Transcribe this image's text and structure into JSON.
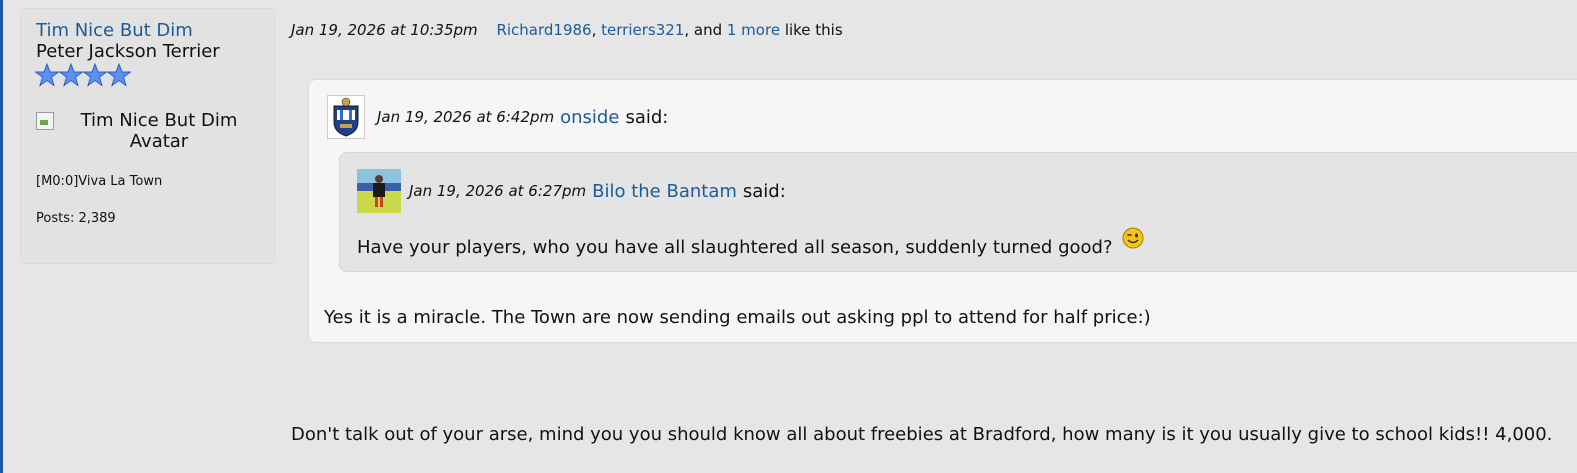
{
  "user": {
    "name": "Tim Nice But Dim",
    "title": "Peter Jackson Terrier",
    "stars": 4,
    "avatar_alt": "Tim Nice But Dim Avatar",
    "rank": "[M0:0]Viva La Town",
    "posts": "Posts: 2,389"
  },
  "post": {
    "date": "Jan 19, 2026 at 10:35pm",
    "likes": {
      "user1": "Richard1986",
      "sep1": ", ",
      "user2": "terriers321",
      "sep2": ", and ",
      "more": "1 more",
      "suffix": " like this"
    },
    "reply": "Don't talk out of your arse, mind you you should know all about freebies at Bradford, how many is it you usually give to school kids!! 4,000."
  },
  "outer_quote": {
    "date": "Jan 19, 2026 at 6:42pm",
    "user": "onside",
    "said": "said:",
    "text": "Yes it is a miracle. The Town are now sending emails out asking ppl to attend for half price:)"
  },
  "inner_quote": {
    "date": "Jan 19, 2026 at 6:27pm",
    "user": "Bilo the Bantam",
    "said": "said:",
    "text": "Have your players, who you have all slaughtered all season, suddenly turned good?"
  },
  "icons": {
    "star": "star-icon",
    "smiley": "wink-smiley-icon",
    "broken_image": "broken-image-icon"
  },
  "colors": {
    "link": "#1c5b9b",
    "background": "#e6e6e6",
    "outer_quote_bg": "#f6f6f6",
    "inner_quote_bg": "#e4e4e4",
    "star": "#5b8ff0"
  }
}
